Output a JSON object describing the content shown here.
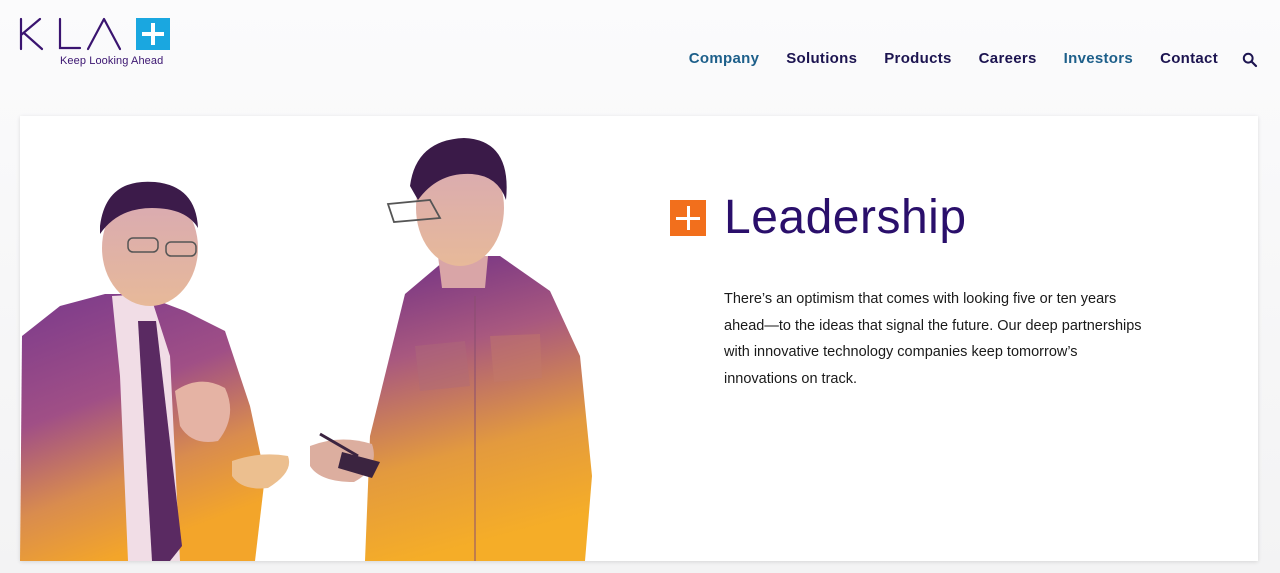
{
  "header": {
    "logo": {
      "wordmark": "KLA",
      "tagline": "Keep Looking Ahead"
    },
    "nav": [
      {
        "label": "Company",
        "active": true
      },
      {
        "label": "Solutions",
        "active": false
      },
      {
        "label": "Products",
        "active": false
      },
      {
        "label": "Careers",
        "active": false
      },
      {
        "label": "Investors",
        "active": true
      },
      {
        "label": "Contact",
        "active": false
      }
    ],
    "search_icon": "search-icon"
  },
  "hero": {
    "heading": "Leadership",
    "body": "There’s an optimism that comes with looking five or ten years ahead—to the ideas that signal the future. Our deep partnerships with innovative technology companies keep tomorrow’s innovations on track.",
    "image_alt": ""
  },
  "colors": {
    "brand_purple": "#2a0f6b",
    "brand_blue": "#1aa7e0",
    "accent_orange": "#f26f1c",
    "nav_active": "#1d5f8a"
  }
}
